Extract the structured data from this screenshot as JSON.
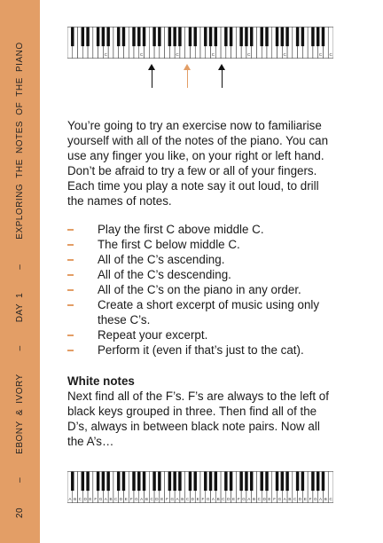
{
  "sidebar": {
    "page_number": "20",
    "sep1": "–",
    "book": "EBONY & IVORY",
    "sep2": "–",
    "day": "DAY 1",
    "sep3": "–",
    "chapter": "EXPLORING THE NOTES OF THE PIANO"
  },
  "colors": {
    "accent": "#e39e66",
    "text": "#1a1a1a"
  },
  "top_keyboard": {
    "white_key_labels": [
      "",
      "",
      "",
      "",
      "",
      "",
      "",
      "C",
      "",
      "",
      "",
      "",
      "",
      "",
      "C",
      "",
      "",
      "",
      "",
      "",
      "",
      "C",
      "",
      "",
      "",
      "",
      "",
      "",
      "C",
      "",
      "",
      "",
      "",
      "",
      "",
      "C",
      "",
      "",
      "",
      "",
      "",
      "",
      "C",
      "",
      "",
      "",
      "",
      "",
      "",
      "C",
      "",
      "C"
    ]
  },
  "arrows": [
    {
      "name": "arrow-c-below",
      "color": "#111111"
    },
    {
      "name": "arrow-middle-c",
      "color": "#e39e66"
    },
    {
      "name": "arrow-c-above",
      "color": "#111111"
    }
  ],
  "intro": "You’re going to try an exercise now to familiarise yourself with all of the notes of the piano. You can use any finger you like, on your right or left hand. Don’t be afraid to try a few or all of your fingers. Each time you play a note say it out loud, to drill the names of notes.",
  "steps": [
    "Play the first C above middle C.",
    "The first C below middle C.",
    "All of the C’s ascending.",
    "All of the C’s descending.",
    "All of the C’s on the piano in any order.",
    "Create a short excerpt of music using only these C’s.",
    "Repeat your excerpt.",
    "Perform it (even if that’s just to the cat)."
  ],
  "white_notes": {
    "title": "White notes",
    "body": "Next find all of the F’s. F’s are always to the left of black keys grouped in three. Then find all of the D’s, always in between black note pairs. Now all the A’s…"
  },
  "bottom_keyboard": {
    "white_key_labels": [
      "A",
      "B",
      "C",
      "D",
      "E",
      "F",
      "G",
      "A",
      "B",
      "C",
      "D",
      "E",
      "F",
      "G",
      "A",
      "B",
      "C",
      "D",
      "E",
      "F",
      "G",
      "A",
      "B",
      "C",
      "D",
      "E",
      "F",
      "G",
      "A",
      "B",
      "C",
      "D",
      "E",
      "F",
      "G",
      "A",
      "B",
      "C",
      "D",
      "E",
      "F",
      "G",
      "A",
      "B",
      "C",
      "D",
      "E",
      "F",
      "G",
      "A",
      "B",
      "C"
    ]
  }
}
